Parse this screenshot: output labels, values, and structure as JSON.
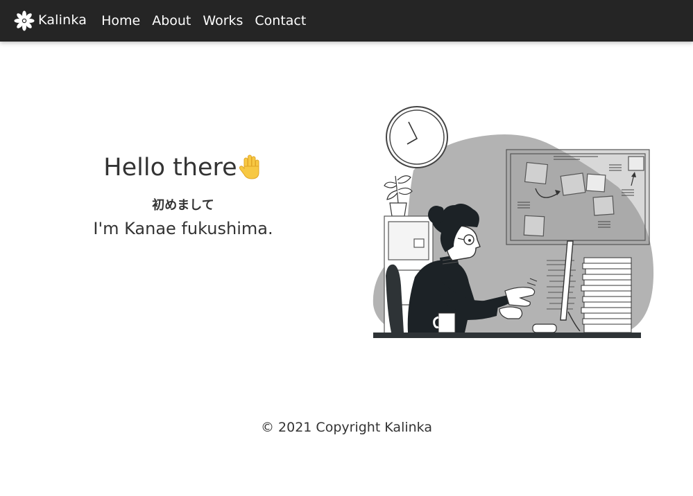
{
  "navbar": {
    "brand": {
      "name": "Kalinka",
      "logo_icon": "flower-logo-icon"
    },
    "links": [
      {
        "label": "Home"
      },
      {
        "label": "About"
      },
      {
        "label": "Works"
      },
      {
        "label": "Contact"
      }
    ],
    "background_color": "#252525"
  },
  "hero": {
    "greeting": "Hello there",
    "greeting_icon": "raised-hand-icon",
    "japanese_greeting": "初めまして",
    "introduction": "I'm Kanae fukushima.",
    "illustration_icon": "woman-working-at-desk-illustration"
  },
  "footer": {
    "copyright": "© 2021 Copyright Kalinka"
  }
}
